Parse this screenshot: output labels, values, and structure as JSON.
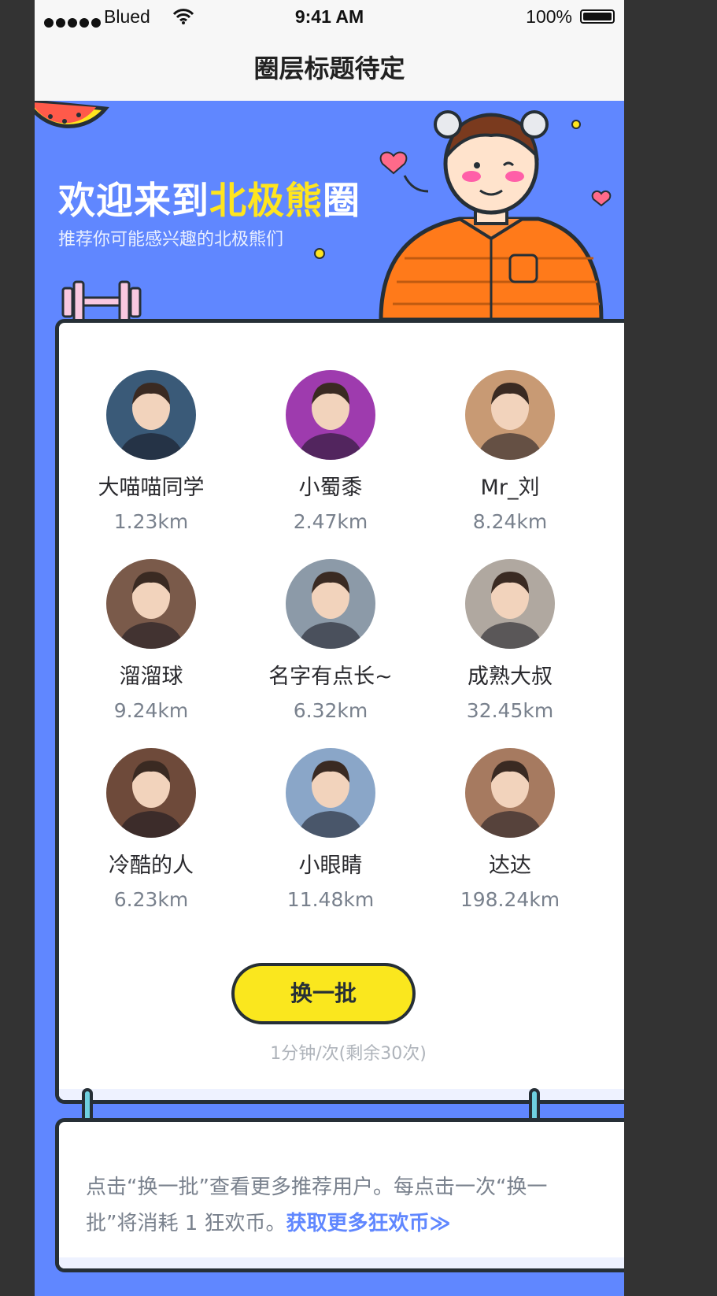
{
  "status_bar": {
    "carrier": "Blued",
    "time": "9:41 AM",
    "battery": "100%"
  },
  "nav": {
    "title": "圈层标题待定"
  },
  "banner": {
    "title_part1": "欢迎来到",
    "title_highlight": "北极熊",
    "title_part2": "圈",
    "subtitle": "推荐你可能感兴趣的北极熊们"
  },
  "colors": {
    "background": "#6087FF",
    "border": "#262F36",
    "name_text": "#2A2A2E",
    "distance_text": "#79818D",
    "button": "#FAE71E",
    "link": "#6087FF"
  },
  "users": [
    {
      "name": "大喵喵同学",
      "distance": "1.23km",
      "avatar_color": "#3A5A78",
      "avatar_icon": "person-avatar-icon"
    },
    {
      "name": "小蜀黍",
      "distance": "2.47km",
      "avatar_color": "#9E3BAE",
      "avatar_icon": "person-avatar-icon"
    },
    {
      "name": "Mr_刘",
      "distance": "8.24km",
      "avatar_color": "#C89A74",
      "avatar_icon": "person-avatar-icon"
    },
    {
      "name": "溜溜球",
      "distance": "9.24km",
      "avatar_color": "#7A5A4A",
      "avatar_icon": "person-avatar-icon"
    },
    {
      "name": "名字有点长~",
      "distance": "6.32km",
      "avatar_color": "#8C9AA8",
      "avatar_icon": "person-avatar-icon"
    },
    {
      "name": "成熟大叔",
      "distance": "32.45km",
      "avatar_color": "#B0A8A0",
      "avatar_icon": "person-avatar-icon"
    },
    {
      "name": "冷酷的人",
      "distance": "6.23km",
      "avatar_color": "#6E4A3A",
      "avatar_icon": "person-avatar-icon"
    },
    {
      "name": "小眼睛",
      "distance": "11.48km",
      "avatar_color": "#8AA6C8",
      "avatar_icon": "person-avatar-icon"
    },
    {
      "name": "达达",
      "distance": "198.24km",
      "avatar_color": "#A67A60",
      "avatar_icon": "person-avatar-icon"
    }
  ],
  "swap": {
    "label": "换一批",
    "note": "1分钟/次(剩余30次)"
  },
  "note": {
    "text": "点击“换一批”查看更多推荐用户。每点击一次“换一批”将消耗 1 狂欢币。",
    "link": "获取更多狂欢币≫"
  }
}
